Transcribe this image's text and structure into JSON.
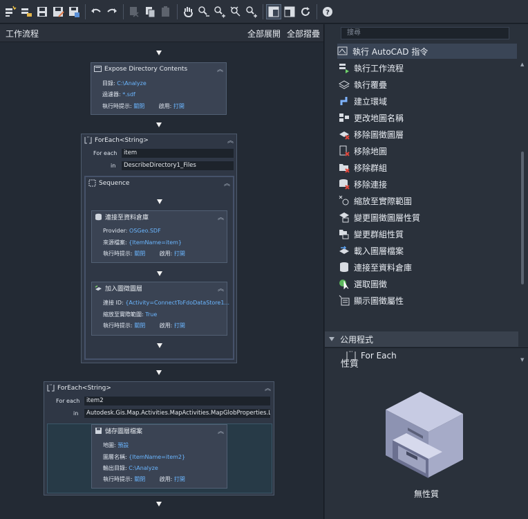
{
  "toolbar": {
    "icons": [
      "new-workflow",
      "open-workflow",
      "save",
      "save-as",
      "save-all",
      "undo",
      "redo",
      "cut",
      "copy",
      "paste",
      "pan",
      "zoom-out",
      "zoom-in",
      "zoom-extents",
      "zoom-window",
      "layout-a",
      "layout-b",
      "refresh",
      "help"
    ]
  },
  "workflow": {
    "title": "工作流程",
    "expand_all": "全部展開",
    "collapse_all": "全部摺疊"
  },
  "expose": {
    "title": "Expose Directory Contents",
    "dir_label": "目錄:",
    "dir_value": "C:\\Analyze",
    "filter_label": "過濾器:",
    "filter_value": "*.sdf",
    "prompt_label": "執行時提示:",
    "prompt_value": "關閉",
    "enable_label": "啟用:",
    "enable_value": "打開"
  },
  "foreach1": {
    "title": "ForEach<String>",
    "foreach_label": "For each",
    "foreach_value": "item",
    "in_label": "in",
    "in_value": "DescribeDirectory1_Files"
  },
  "sequence": {
    "title": "Sequence"
  },
  "connect": {
    "title": "連接至資料倉庫",
    "provider_label": "Provider:",
    "provider_value": "OSGeo.SDF",
    "source_label": "來源檔案:",
    "source_value": "{ItemName=item}",
    "prompt_label": "執行時提示:",
    "prompt_value": "關閉",
    "enable_label": "啟用:",
    "enable_value": "打開"
  },
  "addlayer": {
    "title": "加入圖徵圖層",
    "connid_label": "連接 ID:",
    "connid_value": "{Activity=ConnectToFdoDataStore1...",
    "zoom_label": "縮放至實際範圍:",
    "zoom_value": "True",
    "prompt_label": "執行時提示:",
    "prompt_value": "關閉",
    "enable_label": "啟用:",
    "enable_value": "打開"
  },
  "foreach2": {
    "title": "ForEach<String>",
    "foreach_label": "For each",
    "foreach_value": "item2",
    "in_label": "in",
    "in_value": "Autodesk.Gis.Map.Activities.MapActivities.MapGlobProperties.Layers"
  },
  "savelayer": {
    "title": "儲存圖層檔案",
    "map_label": "地圖:",
    "map_value": "預設",
    "layer_label": "圖層名稱:",
    "layer_value": "{ItemName=item2}",
    "out_label": "輸出目錄:",
    "out_value": "C:\\Analyze",
    "prompt_label": "執行時提示:",
    "prompt_value": "關閉",
    "enable_label": "啟用:",
    "enable_value": "打開"
  },
  "library": {
    "search_placeholder": "搜尋",
    "items": [
      {
        "label": "執行 AutoCAD 指令",
        "icon": "command-icon"
      },
      {
        "label": "執行工作流程",
        "icon": "run-workflow-icon"
      },
      {
        "label": "執行覆疊",
        "icon": "overlay-icon"
      },
      {
        "label": "建立環域",
        "icon": "buffer-icon"
      },
      {
        "label": "更改地圖名稱",
        "icon": "rename-map-icon"
      },
      {
        "label": "移除圖徵圖層",
        "icon": "remove-layer-icon"
      },
      {
        "label": "移除地圖",
        "icon": "remove-map-icon"
      },
      {
        "label": "移除群組",
        "icon": "remove-group-icon"
      },
      {
        "label": "移除連接",
        "icon": "remove-connection-icon"
      },
      {
        "label": "縮放至實際範圍",
        "icon": "zoom-extents-icon"
      },
      {
        "label": "變更圖徵圖層性質",
        "icon": "layer-properties-icon"
      },
      {
        "label": "變更群組性質",
        "icon": "group-properties-icon"
      },
      {
        "label": "載入圖層檔案",
        "icon": "load-layer-icon"
      },
      {
        "label": "連接至資料倉庫",
        "icon": "connect-datastore-icon"
      },
      {
        "label": "選取圖徵",
        "icon": "select-features-icon"
      },
      {
        "label": "顯示圖徵屬性",
        "icon": "show-attributes-icon"
      }
    ],
    "category": "公用程式",
    "category_items": [
      {
        "label": "For Each",
        "icon": "foreach-icon"
      }
    ]
  },
  "properties": {
    "title": "性質",
    "empty": "無性質"
  },
  "colors": {
    "accent": "#6bb6ff",
    "panel": "#2a313b",
    "canvas": "#232a34"
  }
}
